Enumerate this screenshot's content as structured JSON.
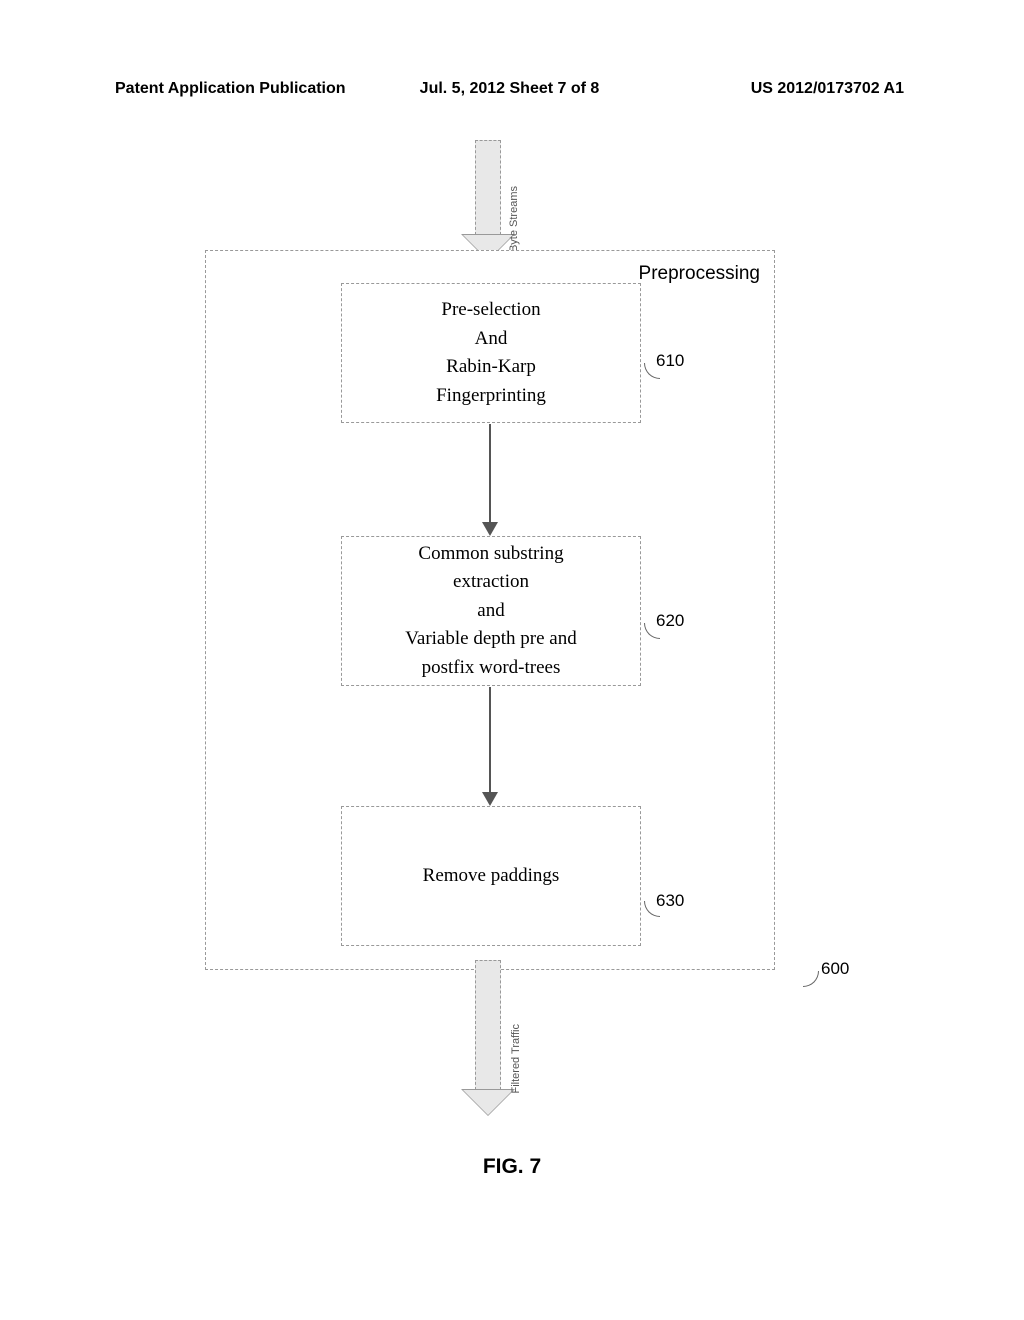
{
  "header": {
    "left": "Patent Application Publication",
    "center": "Jul. 5, 2012    Sheet 7 of 8",
    "right": "US 2012/0173702 A1"
  },
  "diagram": {
    "input_label": "Byte Streams",
    "container_title": "Preprocessing",
    "boxes": {
      "b1": "Pre-selection\nAnd\nRabin-Karp\nFingerprinting",
      "b2": "Common substring\nextraction\nand\nVariable depth pre and\npostfix word-trees",
      "b3": "Remove paddings"
    },
    "refs": {
      "r610": "610",
      "r620": "620",
      "r630": "630",
      "r600": "600"
    },
    "output_label": "Filtered Traffic",
    "figure": "FIG. 7"
  }
}
